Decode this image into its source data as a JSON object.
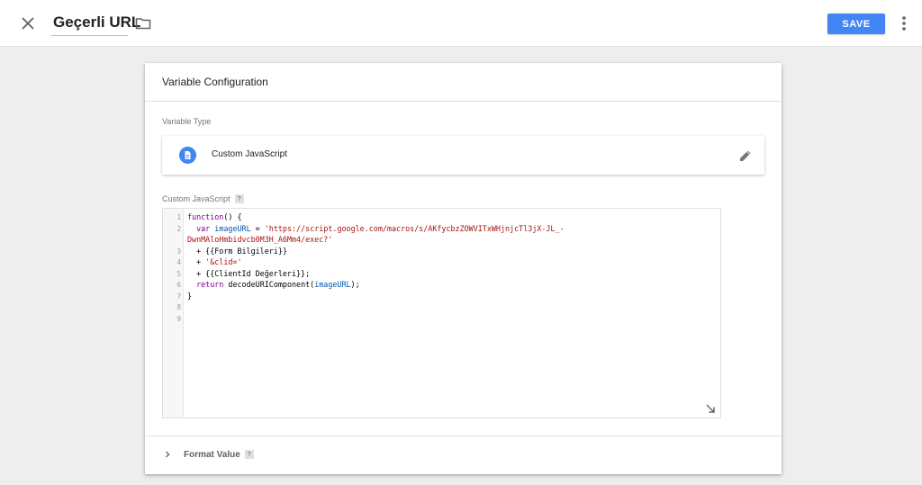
{
  "header": {
    "title": "Geçerli URL",
    "save_label": "SAVE"
  },
  "card": {
    "title": "Variable Configuration",
    "variable_type_label": "Variable Type",
    "variable_type_value": "Custom JavaScript",
    "custom_js_label": "Custom JavaScript",
    "help_text": "?",
    "format_value_label": "Format Value"
  },
  "editor": {
    "line_numbers": [
      "1",
      "2",
      "",
      "3",
      "4",
      "5",
      "6",
      "7",
      "8",
      "9"
    ],
    "lines": [
      "function() {",
      "  var imageURL = 'https://script.google.com/macros/s/AKfycbzZOWVITxWHjnjcTl3jX-JL_-",
      "DwnMAloHmbidvcb0M3H_A6Mm4/exec?'",
      "  + {{Form Bilgileri}}",
      "  + '&clid='",
      "  + {{ClientId Değerleri}};",
      "  return decodeURIComponent(imageURL);",
      "}"
    ]
  },
  "colors": {
    "accent": "#4285f4",
    "keyword": "#770088",
    "variable": "#0055aa",
    "string": "#aa1111"
  },
  "icons": [
    "close-icon",
    "folder-icon",
    "more-vert-icon",
    "document-icon",
    "pencil-icon",
    "help-icon",
    "resize-icon",
    "chevron-right-icon"
  ]
}
